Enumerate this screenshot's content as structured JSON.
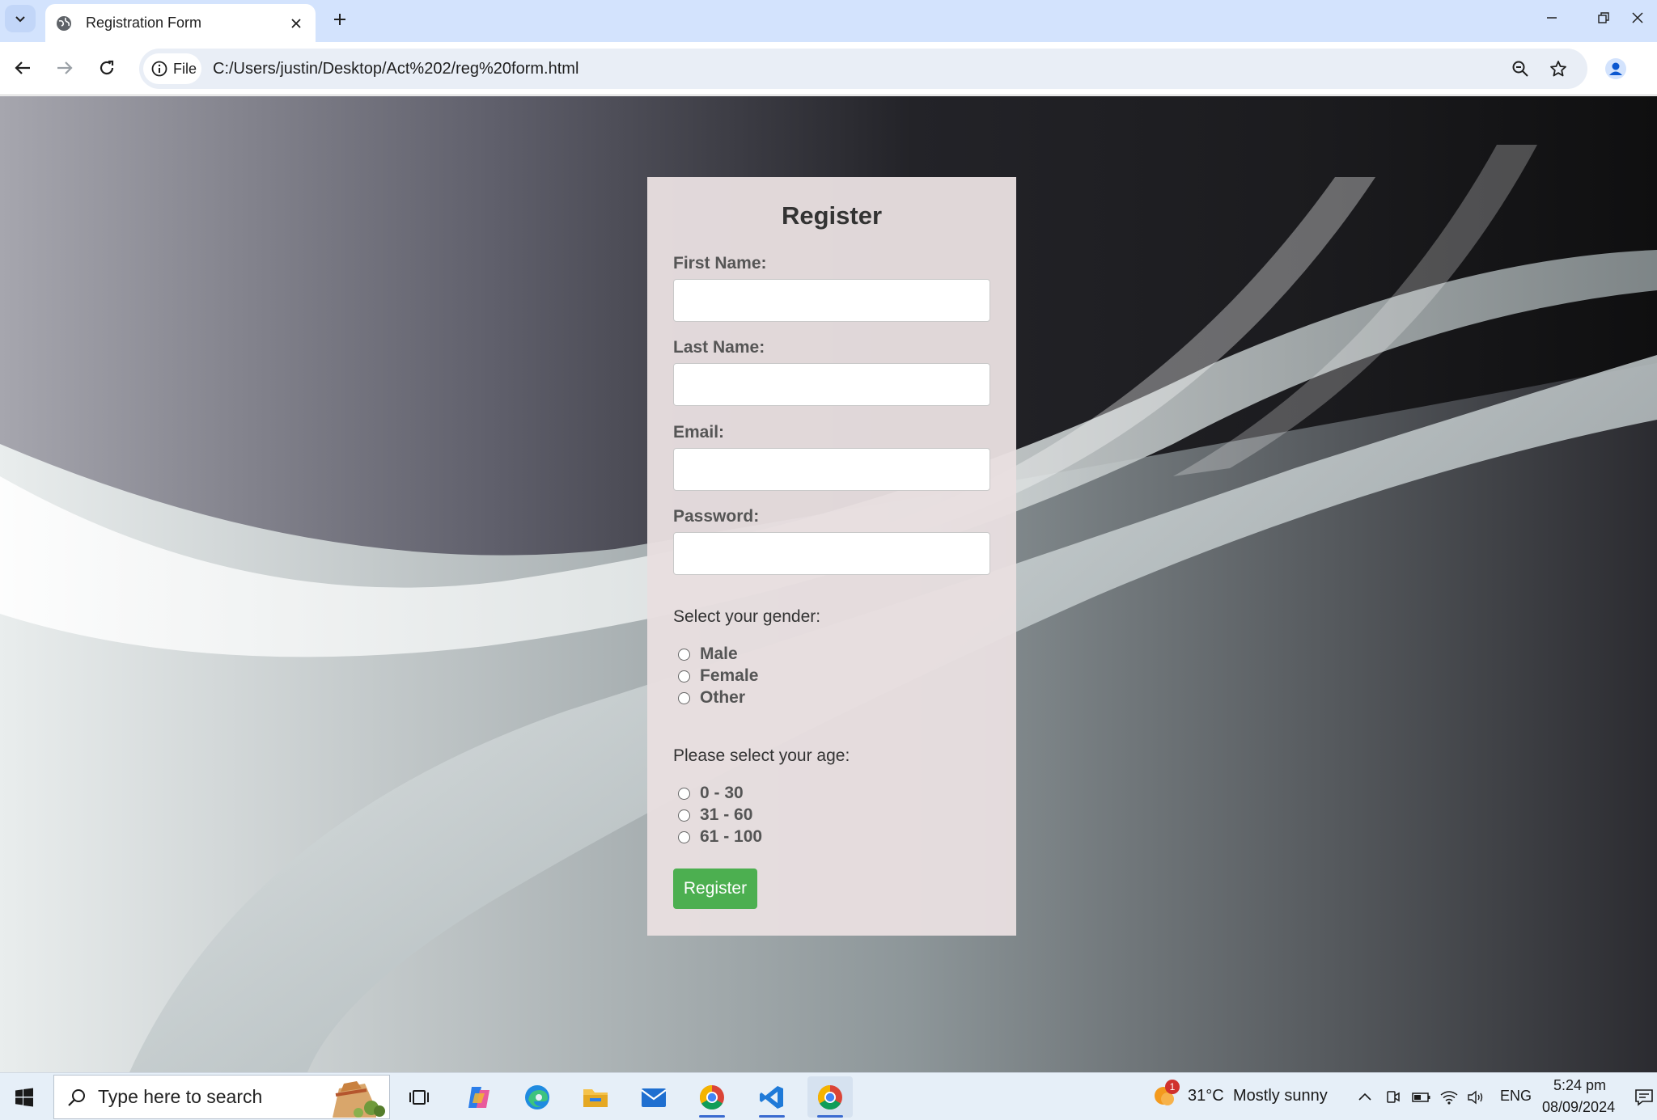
{
  "browser": {
    "tab": {
      "title": "Registration Form"
    },
    "address_bar": {
      "site_chip_label": "File",
      "url": "C:/Users/justin/Desktop/Act%202/reg%20form.html"
    }
  },
  "form": {
    "title": "Register",
    "fields": [
      {
        "label": "First Name:",
        "value": ""
      },
      {
        "label": "Last Name:",
        "value": ""
      },
      {
        "label": "Email:",
        "value": ""
      },
      {
        "label": "Password:",
        "value": ""
      }
    ],
    "gender": {
      "label": "Select your gender:",
      "options": [
        "Male",
        "Female",
        "Other"
      ]
    },
    "age": {
      "label": "Please select your age:",
      "options": [
        "0 - 30",
        "31 - 60",
        "61 - 100"
      ]
    },
    "submit_label": "Register",
    "accent_color": "#4caf50"
  },
  "taskbar": {
    "search_placeholder": "Type here to search",
    "weather": {
      "temperature": "31°C",
      "condition": "Mostly sunny",
      "badge": "1"
    },
    "language": "ENG",
    "time": "5:24 pm",
    "date": "08/09/2024",
    "apps": [
      "task-view",
      "copilot",
      "edge",
      "file-explorer",
      "mail",
      "chrome",
      "vscode",
      "chrome"
    ]
  }
}
